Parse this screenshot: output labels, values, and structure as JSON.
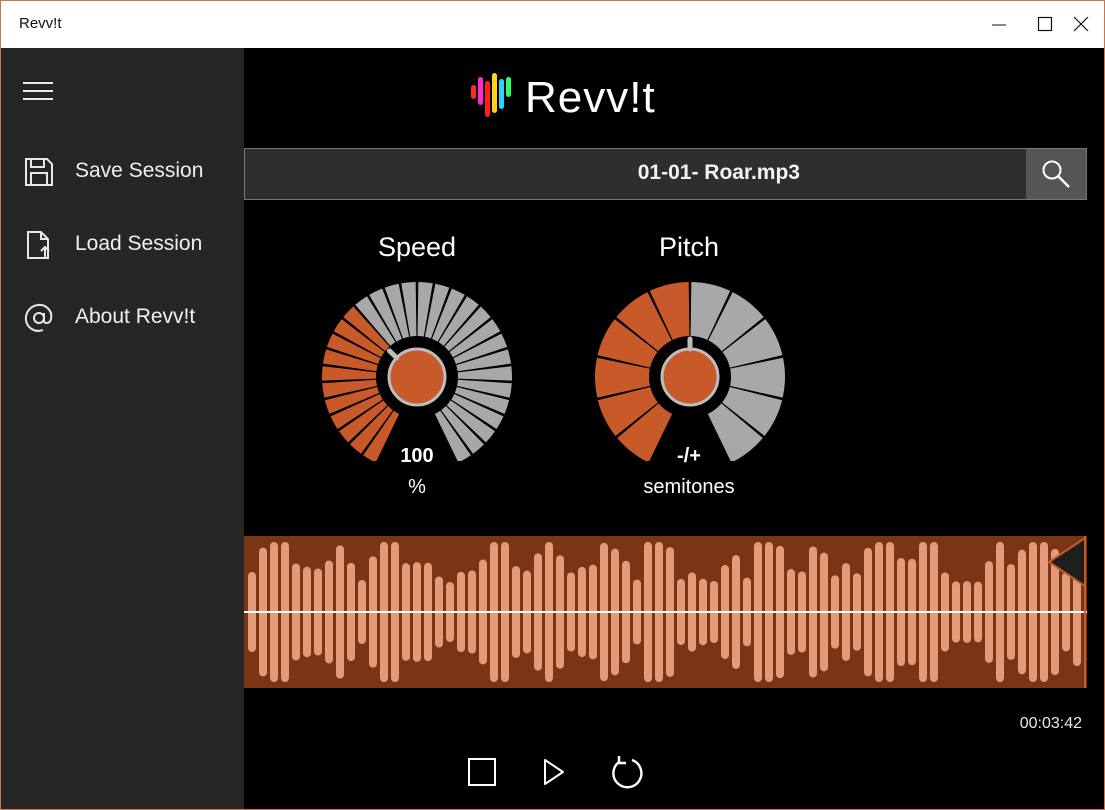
{
  "window": {
    "title": "Revv!t"
  },
  "sidebar": {
    "items": [
      {
        "label": "Save Session",
        "icon": "floppy-disk-icon"
      },
      {
        "label": "Load Session",
        "icon": "document-upload-icon"
      },
      {
        "label": "About Revv!t",
        "icon": "at-sign-icon"
      }
    ]
  },
  "app": {
    "logo_text": "Revv!t"
  },
  "file": {
    "name": "01-01- Roar.mp3"
  },
  "speed": {
    "title": "Speed",
    "value": "100",
    "unit": "%",
    "level": 0.35
  },
  "pitch": {
    "title": "Pitch",
    "value": "-/+",
    "unit": "semitones",
    "level": 0.5
  },
  "player": {
    "time": "00:03:42",
    "progress": 1.0
  },
  "colors": {
    "accent": "#c85a2a",
    "segment_off": "#a8a8a8",
    "wave_bg": "#7a3517",
    "wave_bar": "#e29a78"
  }
}
